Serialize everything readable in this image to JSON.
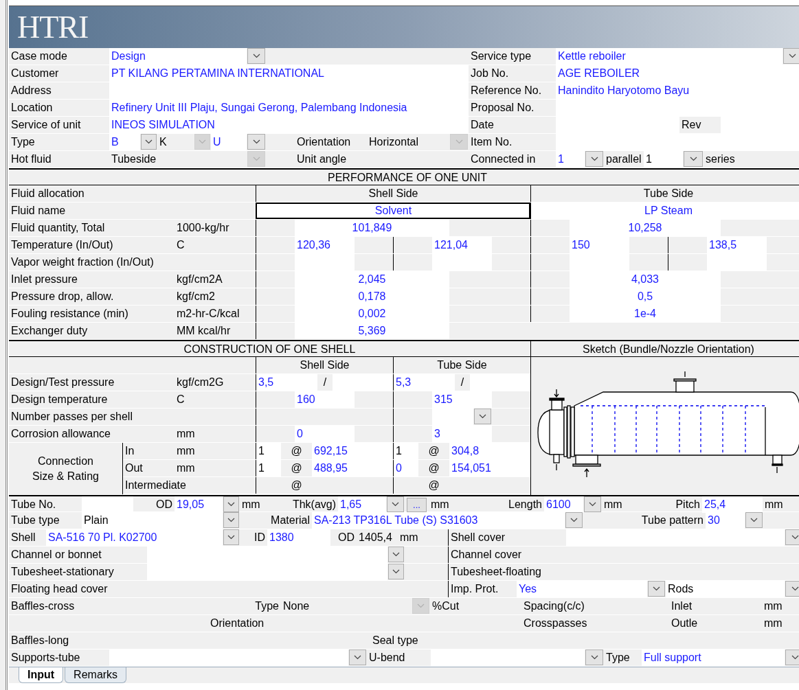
{
  "logo": "HTRI",
  "general": {
    "lines": [
      {
        "items": [
          {
            "kind": "label",
            "text": "Case mode"
          },
          {
            "kind": "input",
            "text": "Design"
          },
          {
            "kind": "dropdown",
            "disabled": false
          },
          {
            "kind": "blank"
          },
          {
            "kind": "label",
            "text": "Service type"
          },
          {
            "kind": "input",
            "text": "Kettle reboiler"
          },
          {
            "kind": "dropdown",
            "disabled": false
          }
        ]
      },
      {
        "items": [
          {
            "kind": "label",
            "text": "Customer"
          },
          {
            "kind": "input",
            "text": "PT KILANG PERTAMINA INTERNATIONAL"
          },
          {
            "kind": "label",
            "text": "Job No."
          },
          {
            "kind": "input",
            "text": "AGE REBOILER"
          }
        ]
      },
      {
        "items": [
          {
            "kind": "label",
            "text": "Address"
          },
          {
            "kind": "input"
          },
          {
            "kind": "label",
            "text": "Reference No."
          },
          {
            "kind": "input",
            "text": "Hanindito Haryotomo Bayu"
          }
        ]
      },
      {
        "items": [
          {
            "kind": "label",
            "text": "Location"
          },
          {
            "kind": "input",
            "text": "Refinery Unit III Plaju, Sungai Gerong, Palembang Indonesia"
          },
          {
            "kind": "label",
            "text": "Proposal No."
          },
          {
            "kind": "input"
          }
        ]
      },
      {
        "items": [
          {
            "kind": "label",
            "text": "Service of unit"
          },
          {
            "kind": "input",
            "text": "INEOS SIMULATION"
          },
          {
            "kind": "label",
            "text": "Date"
          },
          {
            "kind": "input"
          },
          {
            "kind": "label",
            "text": "Rev"
          },
          {
            "kind": "input"
          }
        ]
      },
      {
        "items": [
          {
            "kind": "label",
            "text": "Type"
          },
          {
            "kind": "input",
            "text": "B"
          },
          {
            "kind": "dropdown",
            "disabled": false
          },
          {
            "kind": "value",
            "text": "K"
          },
          {
            "kind": "dropdown",
            "disabled": true
          },
          {
            "kind": "input",
            "text": "U"
          },
          {
            "kind": "dropdown",
            "disabled": false
          },
          {
            "kind": "blank"
          },
          {
            "kind": "label",
            "text": "Orientation"
          },
          {
            "kind": "value",
            "text": "Horizontal"
          },
          {
            "kind": "dropdown",
            "disabled": true
          },
          {
            "kind": "label",
            "text": "Item No."
          },
          {
            "kind": "input"
          }
        ]
      },
      {
        "items": [
          {
            "kind": "label",
            "text": "Hot fluid"
          },
          {
            "kind": "value",
            "text": "Tubeside"
          },
          {
            "kind": "dropdown",
            "disabled": true
          },
          {
            "kind": "blank"
          },
          {
            "kind": "label",
            "text": "Unit angle"
          },
          {
            "kind": "label",
            "text": "Connected in"
          },
          {
            "kind": "input",
            "text": "1"
          },
          {
            "kind": "dropdown",
            "disabled": false
          },
          {
            "kind": "label",
            "text": "parallel"
          },
          {
            "kind": "fixed",
            "text": "1"
          },
          {
            "kind": "dropdown",
            "disabled": false
          },
          {
            "kind": "label",
            "text": "series"
          }
        ]
      }
    ]
  },
  "performance": {
    "lines": [
      {
        "items": [
          {
            "kind": "heading",
            "text": "PERFORMANCE OF ONE UNIT"
          }
        ]
      },
      {
        "items": [
          {
            "kind": "label",
            "text": "Fluid allocation"
          },
          {
            "kind": "heading",
            "text": "Shell Side"
          },
          {
            "kind": "heading",
            "text": "Tube Side"
          }
        ]
      },
      {
        "items": [
          {
            "kind": "label",
            "text": "Fluid name"
          },
          {
            "kind": "input",
            "text": "Solvent",
            "focused": true
          },
          {
            "kind": "input",
            "text": "LP Steam",
            "focused": false
          }
        ]
      },
      {
        "items": [
          {
            "kind": "label",
            "text": "Fluid quantity, Total"
          },
          {
            "kind": "unit",
            "text": "1000-kg/hr"
          },
          {
            "kind": "blank"
          },
          {
            "kind": "input",
            "text": "101,849"
          },
          {
            "kind": "blank"
          },
          {
            "kind": "blank"
          },
          {
            "kind": "input",
            "text": "10,258"
          },
          {
            "kind": "blank"
          }
        ]
      },
      {
        "items": [
          {
            "kind": "label",
            "text": "Temperature (In/Out)"
          },
          {
            "kind": "unit",
            "text": "C"
          },
          {
            "kind": "blank"
          },
          {
            "kind": "input",
            "text": "120,36"
          },
          {
            "kind": "blank"
          },
          {
            "kind": "blank"
          },
          {
            "kind": "input",
            "text": "121,04"
          },
          {
            "kind": "blank"
          },
          {
            "kind": "blank"
          },
          {
            "kind": "input",
            "text": "150"
          },
          {
            "kind": "blank"
          },
          {
            "kind": "blank"
          },
          {
            "kind": "input",
            "text": "138,5"
          },
          {
            "kind": "blank"
          }
        ]
      },
      {
        "items": [
          {
            "kind": "label",
            "text": "Vapor weight fraction (In/Out)"
          },
          {
            "kind": "blank"
          },
          {
            "kind": "input"
          },
          {
            "kind": "blank"
          },
          {
            "kind": "blank"
          },
          {
            "kind": "input"
          },
          {
            "kind": "blank"
          },
          {
            "kind": "blank"
          },
          {
            "kind": "input"
          },
          {
            "kind": "blank"
          },
          {
            "kind": "blank"
          },
          {
            "kind": "input"
          },
          {
            "kind": "blank"
          }
        ]
      },
      {
        "items": [
          {
            "kind": "label",
            "text": "Inlet pressure"
          },
          {
            "kind": "unit",
            "text": "kgf/cm2A"
          },
          {
            "kind": "blank"
          },
          {
            "kind": "input",
            "text": "2,045"
          },
          {
            "kind": "blank"
          },
          {
            "kind": "blank"
          },
          {
            "kind": "input",
            "text": "4,033"
          },
          {
            "kind": "blank"
          }
        ]
      },
      {
        "items": [
          {
            "kind": "label",
            "text": "Pressure drop, allow."
          },
          {
            "kind": "unit",
            "text": "kgf/cm2"
          },
          {
            "kind": "blank"
          },
          {
            "kind": "input",
            "text": "0,178"
          },
          {
            "kind": "blank"
          },
          {
            "kind": "blank"
          },
          {
            "kind": "input",
            "text": "0,5"
          },
          {
            "kind": "blank"
          }
        ]
      },
      {
        "items": [
          {
            "kind": "label",
            "text": "Fouling resistance (min)"
          },
          {
            "kind": "unit",
            "text": "m2-hr-C/kcal"
          },
          {
            "kind": "blank"
          },
          {
            "kind": "input",
            "text": "0,002"
          },
          {
            "kind": "blank"
          },
          {
            "kind": "blank"
          },
          {
            "kind": "input",
            "text": "1e-4"
          },
          {
            "kind": "blank"
          }
        ]
      },
      {
        "items": [
          {
            "kind": "label",
            "text": "Exchanger duty"
          },
          {
            "kind": "unit",
            "text": "MM kcal/hr"
          },
          {
            "kind": "blank"
          },
          {
            "kind": "input",
            "text": "5,369"
          },
          {
            "kind": "blank"
          }
        ]
      }
    ]
  },
  "construction": {
    "heading_row": [
      {
        "kind": "heading",
        "text": "CONSTRUCTION OF ONE SHELL"
      },
      {
        "kind": "heading",
        "text": "Sketch (Bundle/Nozzle Orientation)"
      }
    ],
    "lines": [
      {
        "items": [
          {
            "kind": "blank"
          },
          {
            "kind": "heading",
            "text": "Shell Side"
          },
          {
            "kind": "heading",
            "text": "Tube Side"
          }
        ]
      },
      {
        "items": [
          {
            "kind": "label",
            "text": "Design/Test pressure"
          },
          {
            "kind": "unit",
            "text": "kgf/cm2G"
          },
          {
            "kind": "input",
            "text": "3,5"
          },
          {
            "kind": "label",
            "text": "/"
          },
          {
            "kind": "input"
          },
          {
            "kind": "input",
            "text": "5,3"
          },
          {
            "kind": "label",
            "text": "/"
          },
          {
            "kind": "input"
          }
        ]
      },
      {
        "items": [
          {
            "kind": "label",
            "text": "Design temperature"
          },
          {
            "kind": "unit",
            "text": "C"
          },
          {
            "kind": "blank"
          },
          {
            "kind": "input",
            "text": "160"
          },
          {
            "kind": "blank"
          },
          {
            "kind": "blank"
          },
          {
            "kind": "input",
            "text": "315"
          },
          {
            "kind": "blank"
          }
        ]
      },
      {
        "items": [
          {
            "kind": "label",
            "text": "Number passes per shell"
          },
          {
            "kind": "blank"
          },
          {
            "kind": "blank"
          },
          {
            "kind": "input"
          },
          {
            "kind": "dropdown",
            "disabled": false
          },
          {
            "kind": "blank"
          }
        ]
      },
      {
        "items": [
          {
            "kind": "label",
            "text": "Corrosion allowance"
          },
          {
            "kind": "unit",
            "text": "mm"
          },
          {
            "kind": "blank"
          },
          {
            "kind": "input",
            "text": "0"
          },
          {
            "kind": "blank"
          },
          {
            "kind": "blank"
          },
          {
            "kind": "input",
            "text": "3"
          },
          {
            "kind": "blank"
          }
        ]
      }
    ],
    "connection": {
      "label": "Connection Size & Rating",
      "lines": [
        {
          "items": [
            {
              "kind": "label",
              "text": "In"
            },
            {
              "kind": "unit",
              "text": "mm"
            },
            {
              "kind": "fixed",
              "text": "1"
            },
            {
              "kind": "label",
              "text": "@"
            },
            {
              "kind": "input",
              "text": "692,15"
            },
            {
              "kind": "fixed",
              "text": "1"
            },
            {
              "kind": "label",
              "text": "@"
            },
            {
              "kind": "input",
              "text": "304,8"
            }
          ]
        },
        {
          "items": [
            {
              "kind": "label",
              "text": "Out"
            },
            {
              "kind": "unit",
              "text": "mm"
            },
            {
              "kind": "fixed",
              "text": "1"
            },
            {
              "kind": "label",
              "text": "@"
            },
            {
              "kind": "input",
              "text": "488,95"
            },
            {
              "kind": "input",
              "text": "0"
            },
            {
              "kind": "label",
              "text": "@"
            },
            {
              "kind": "input",
              "text": "154,051"
            }
          ]
        },
        {
          "items": [
            {
              "kind": "label",
              "text": "Intermediate"
            },
            {
              "kind": "blank"
            },
            {
              "kind": "label",
              "text": "@"
            },
            {
              "kind": "blank"
            },
            {
              "kind": "blank"
            },
            {
              "kind": "label",
              "text": "@"
            },
            {
              "kind": "blank"
            }
          ]
        }
      ]
    }
  },
  "tube_and_shell": {
    "lines": [
      {
        "items": [
          {
            "kind": "label",
            "text": "Tube No."
          },
          {
            "kind": "input"
          },
          {
            "kind": "label",
            "text": "OD"
          },
          {
            "kind": "input",
            "text": "19,05"
          },
          {
            "kind": "dropdown",
            "disabled": false
          },
          {
            "kind": "unit",
            "text": "mm"
          },
          {
            "kind": "label",
            "text": "Thk(avg)"
          },
          {
            "kind": "input",
            "text": "1,65"
          },
          {
            "kind": "dropdown",
            "disabled": false
          },
          {
            "kind": "button",
            "text": "..."
          },
          {
            "kind": "unit",
            "text": "mm"
          },
          {
            "kind": "label",
            "text": "Length"
          },
          {
            "kind": "input",
            "text": "6100"
          },
          {
            "kind": "dropdown",
            "disabled": false
          },
          {
            "kind": "unit",
            "text": "mm"
          },
          {
            "kind": "label",
            "text": "Pitch"
          },
          {
            "kind": "input",
            "text": "25,4"
          },
          {
            "kind": "unit",
            "text": "mm"
          }
        ]
      },
      {
        "items": [
          {
            "kind": "label",
            "text": "Tube type"
          },
          {
            "kind": "fixed",
            "text": "Plain"
          },
          {
            "kind": "dropdown",
            "disabled": false
          },
          {
            "kind": "label",
            "text": "Material"
          },
          {
            "kind": "input",
            "text": "SA-213 TP316L Tube (S) S31603"
          },
          {
            "kind": "dropdown",
            "disabled": false
          },
          {
            "kind": "label",
            "text": "Tube pattern"
          },
          {
            "kind": "input",
            "text": "30"
          },
          {
            "kind": "dropdown",
            "disabled": false
          },
          {
            "kind": "blank"
          }
        ]
      },
      {
        "items": [
          {
            "kind": "label",
            "text": "Shell"
          },
          {
            "kind": "input",
            "text": "SA-516 70 Pl. K02700"
          },
          {
            "kind": "dropdown",
            "disabled": false
          },
          {
            "kind": "label",
            "text": "ID"
          },
          {
            "kind": "input",
            "text": "1380"
          },
          {
            "kind": "label",
            "text": "OD"
          },
          {
            "kind": "value",
            "text": "1405,4"
          },
          {
            "kind": "unit",
            "text": "mm"
          },
          {
            "kind": "label",
            "text": "Shell cover"
          },
          {
            "kind": "input"
          },
          {
            "kind": "dropdown",
            "disabled": false
          }
        ]
      },
      {
        "items": [
          {
            "kind": "label",
            "text": "Channel or bonnet"
          },
          {
            "kind": "input"
          },
          {
            "kind": "dropdown",
            "disabled": false
          },
          {
            "kind": "blank"
          },
          {
            "kind": "label",
            "text": "Channel cover"
          }
        ]
      },
      {
        "items": [
          {
            "kind": "label",
            "text": "Tubesheet-stationary"
          },
          {
            "kind": "input"
          },
          {
            "kind": "dropdown",
            "disabled": false
          },
          {
            "kind": "blank"
          },
          {
            "kind": "label",
            "text": "Tubesheet-floating"
          }
        ]
      },
      {
        "items": [
          {
            "kind": "label",
            "text": "Floating head cover"
          },
          {
            "kind": "label",
            "text": "Imp. Prot."
          },
          {
            "kind": "input",
            "text": "Yes"
          },
          {
            "kind": "dropdown",
            "disabled": false
          },
          {
            "kind": "fixed",
            "text": "Rods"
          },
          {
            "kind": "dropdown",
            "disabled": false
          }
        ]
      },
      {
        "items": [
          {
            "kind": "label",
            "text": "Baffles-cross"
          },
          {
            "kind": "label",
            "text": "Type"
          },
          {
            "kind": "value",
            "text": "None"
          },
          {
            "kind": "dropdown",
            "disabled": true
          },
          {
            "kind": "label",
            "text": "%Cut"
          },
          {
            "kind": "label",
            "text": "Spacing(c/c)"
          },
          {
            "kind": "label",
            "text": "Inlet"
          },
          {
            "kind": "unit",
            "text": "mm"
          }
        ]
      },
      {
        "items": [
          {
            "kind": "blank"
          },
          {
            "kind": "label",
            "text": "Orientation"
          },
          {
            "kind": "label",
            "text": "Crosspasses"
          },
          {
            "kind": "label",
            "text": "Outle"
          },
          {
            "kind": "unit",
            "text": "mm"
          }
        ]
      },
      {
        "items": [
          {
            "kind": "label",
            "text": "Baffles-long"
          },
          {
            "kind": "label",
            "text": "Seal type"
          }
        ]
      },
      {
        "items": [
          {
            "kind": "label",
            "text": "Supports-tube"
          },
          {
            "kind": "input"
          },
          {
            "kind": "dropdown",
            "disabled": false
          },
          {
            "kind": "label",
            "text": "U-bend"
          },
          {
            "kind": "input"
          },
          {
            "kind": "dropdown",
            "disabled": false
          },
          {
            "kind": "label",
            "text": "Type"
          },
          {
            "kind": "input",
            "text": "Full support"
          },
          {
            "kind": "dropdown",
            "disabled": false
          }
        ]
      }
    ]
  },
  "tabs": [
    {
      "label": "Input",
      "selected": true
    },
    {
      "label": "Remarks",
      "selected": false
    }
  ]
}
